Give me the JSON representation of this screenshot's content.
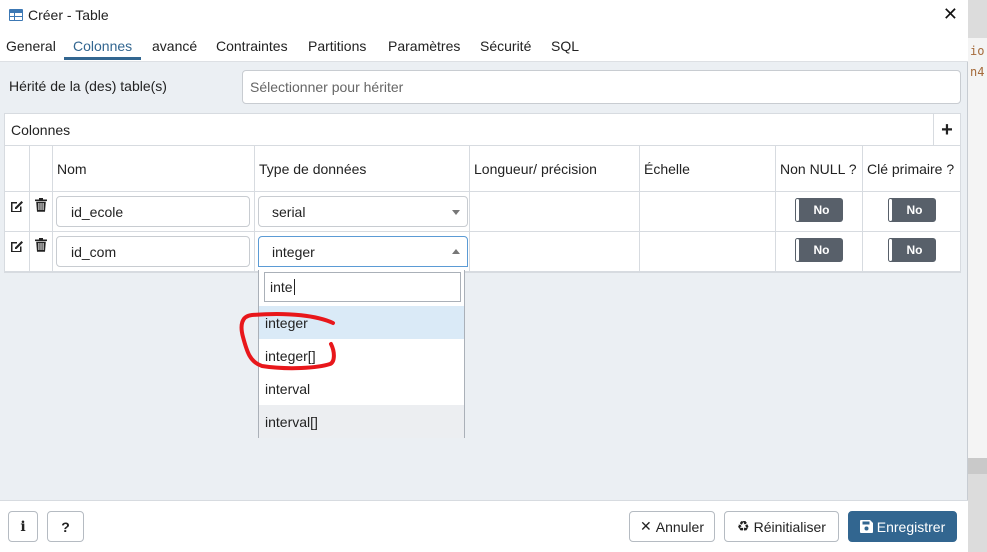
{
  "window": {
    "title": "Créer - Table"
  },
  "tabs": [
    {
      "label": "General"
    },
    {
      "label": "Colonnes"
    },
    {
      "label": "avancé"
    },
    {
      "label": "Contraintes"
    },
    {
      "label": "Partitions"
    },
    {
      "label": "Paramètres"
    },
    {
      "label": "Sécurité"
    },
    {
      "label": "SQL"
    }
  ],
  "active_tab": "Colonnes",
  "inherit": {
    "label": "Hérité de la (des) table(s)",
    "placeholder": "Sélectionner pour hériter"
  },
  "columns_panel": {
    "title": "Colonnes",
    "headers": [
      "Nom",
      "Type de données",
      "Longueur/ précision",
      "Échelle",
      "Non NULL ?",
      "Clé primaire ?"
    ],
    "rows": [
      {
        "name": "id_ecole",
        "type": "serial",
        "not_null": "No",
        "primary_key": "No"
      },
      {
        "name": "id_com",
        "type": "integer",
        "not_null": "No",
        "primary_key": "No"
      }
    ]
  },
  "type_dropdown": {
    "search_value": "inte",
    "options": [
      "integer",
      "integer[]",
      "interval",
      "interval[]"
    ],
    "highlighted": "integer",
    "hovered": "interval[]"
  },
  "background_code": {
    "lines": [
      "io",
      "n4"
    ]
  },
  "footer": {
    "info_label": "i",
    "help_label": "?",
    "cancel_label": "Annuler",
    "reset_label": "Réinitialiser",
    "save_label": "Enregistrer"
  },
  "colors": {
    "accent": "#326690",
    "toggle_bg": "#58606a",
    "highlight_bg": "#daeaf7",
    "annotation": "#e8171b"
  }
}
